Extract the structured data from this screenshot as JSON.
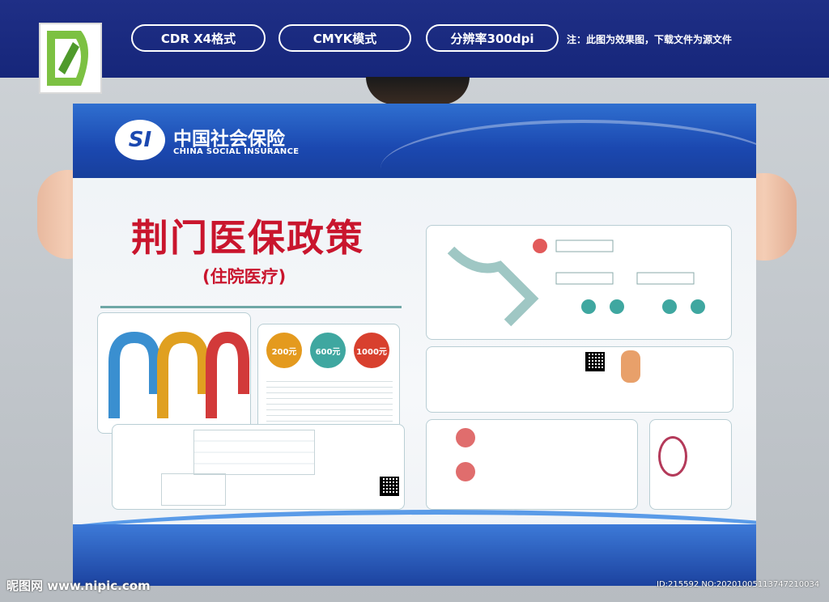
{
  "banner": {
    "pills": [
      "CDR X4格式",
      "CMYK模式",
      "分辨率300dpi"
    ],
    "note": "注：此图为效果图，下载文件为源文件"
  },
  "poster": {
    "logo_mark": "SI",
    "brand_cn": "中国社会保险",
    "brand_en": "CHINA SOCIAL INSURANCE",
    "title": "荆门医保政策",
    "subtitle": "(住院医疗)",
    "amounts": [
      "200元",
      "600元",
      "1000元"
    ]
  },
  "footer": {
    "watermark": "昵图网 www.nipic.com",
    "id": "ID:215592 NO:20201005113747210034"
  },
  "colors": {
    "banner": "#1f2f86",
    "title": "#c9152d",
    "teal": "#2f8f88",
    "blue_head": "#1b48b0"
  }
}
